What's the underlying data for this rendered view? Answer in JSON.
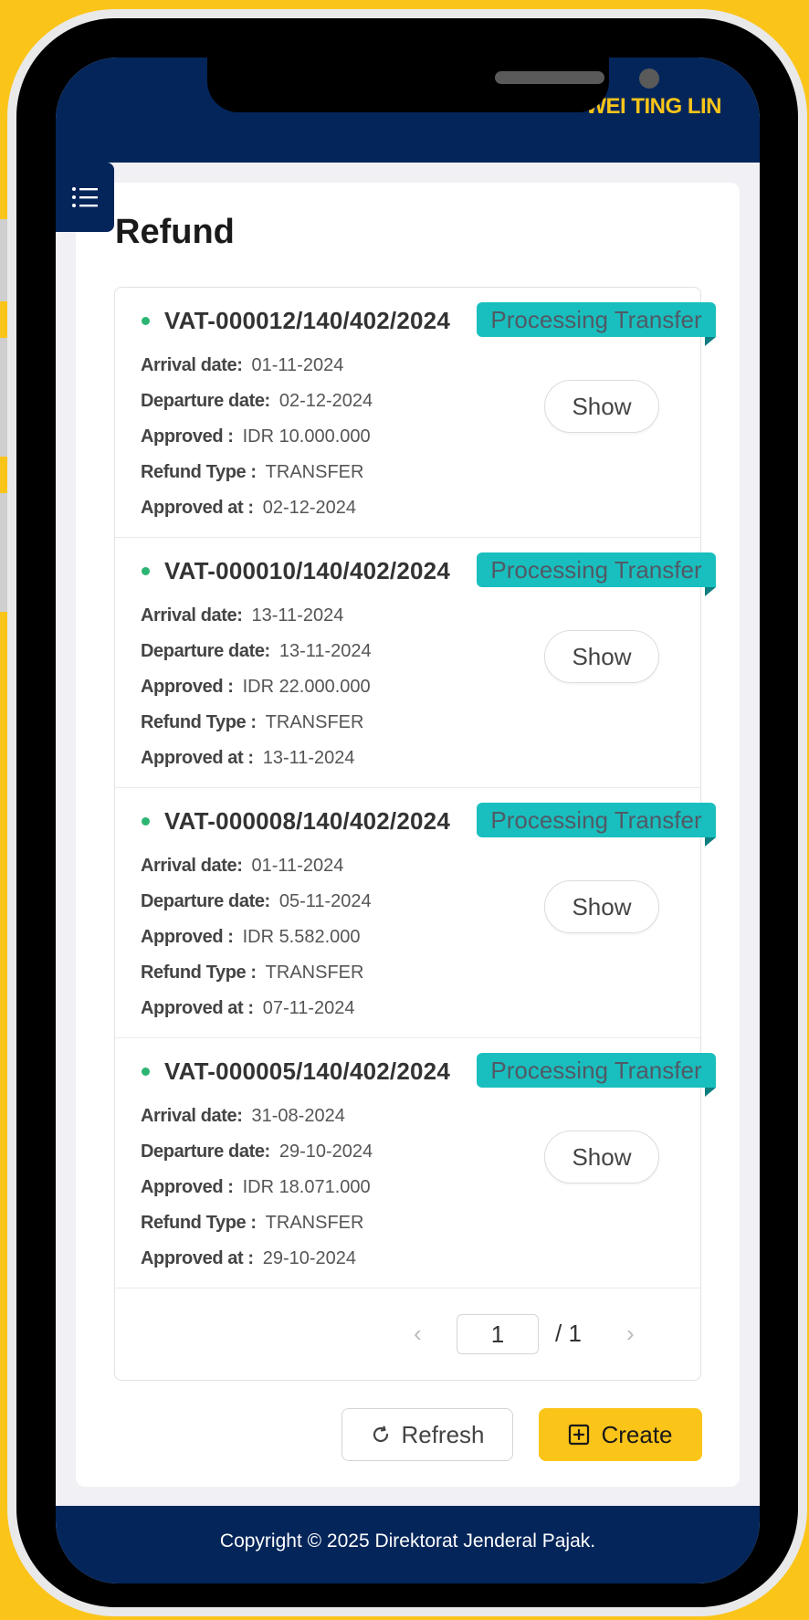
{
  "header": {
    "user_name": "WEI TING LIN"
  },
  "page": {
    "title": "Refund"
  },
  "labels": {
    "arrival": "Arrival date:",
    "departure": "Departure date:",
    "approved": "Approved :",
    "refund_type": "Refund Type :",
    "approved_at": "Approved at :",
    "show": "Show"
  },
  "refunds": [
    {
      "id": "VAT-000012/140/402/2024",
      "status": "Processing Transfer",
      "arrival_date": "01-11-2024",
      "departure_date": "02-12-2024",
      "approved": "IDR 10.000.000",
      "refund_type": "TRANSFER",
      "approved_at": "02-12-2024"
    },
    {
      "id": "VAT-000010/140/402/2024",
      "status": "Processing Transfer",
      "arrival_date": "13-11-2024",
      "departure_date": "13-11-2024",
      "approved": "IDR 22.000.000",
      "refund_type": "TRANSFER",
      "approved_at": "13-11-2024"
    },
    {
      "id": "VAT-000008/140/402/2024",
      "status": "Processing Transfer",
      "arrival_date": "01-11-2024",
      "departure_date": "05-11-2024",
      "approved": "IDR 5.582.000",
      "refund_type": "TRANSFER",
      "approved_at": "07-11-2024"
    },
    {
      "id": "VAT-000005/140/402/2024",
      "status": "Processing Transfer",
      "arrival_date": "31-08-2024",
      "departure_date": "29-10-2024",
      "approved": "IDR 18.071.000",
      "refund_type": "TRANSFER",
      "approved_at": "29-10-2024"
    }
  ],
  "pagination": {
    "current": "1",
    "total": "/ 1",
    "prev_icon": "chevron-left-icon",
    "next_icon": "chevron-right-icon"
  },
  "actions": {
    "refresh": "Refresh",
    "create": "Create"
  },
  "footer": {
    "copyright": "Copyright © 2025 Direktorat Jenderal Pajak."
  },
  "colors": {
    "navy": "#03255A",
    "accent": "#FBC419",
    "status": "#19BFBE"
  }
}
